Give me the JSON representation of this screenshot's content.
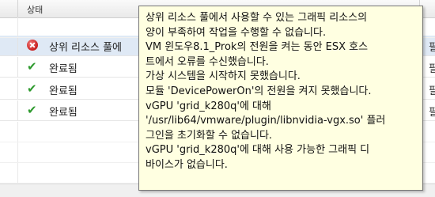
{
  "header": {
    "status_column": "상태"
  },
  "rows": [
    {
      "status": "error",
      "icon": "error-icon",
      "label": "상위 리소스 풀에",
      "right": "필"
    },
    {
      "status": "done",
      "icon": "checkmark-icon",
      "label": "완료됨",
      "right": "필"
    },
    {
      "status": "done",
      "icon": "checkmark-icon",
      "label": "완료됨",
      "right": "필"
    },
    {
      "status": "done",
      "icon": "checkmark-icon",
      "label": "완료됨",
      "right": "필"
    }
  ],
  "tooltip": {
    "lines": [
      "상위 리소스 풀에서 사용할 수 있는 그래픽 리소스의",
      "양이 부족하여 작업을 수행할 수 없습니다.",
      "VM 윈도우8.1_Prok의 전원을 켜는 동안 ESX 호스",
      "트에서 오류를 수신했습니다.",
      "가상 시스템을 시작하지 못했습니다.",
      "모듈 'DevicePowerOn'의 전원을 켜지 못했습니다.",
      "vGPU 'grid_k280q'에 대해",
      "'/usr/lib64/vmware/plugin/libnvidia-vgx.so' 플러",
      "그인을 초기화할 수 없습니다.",
      "vGPU 'grid_k280q'에 대해 사용 가능한 그래픽 디",
      "바이스가 없습니다."
    ]
  },
  "colors": {
    "selected_row": "#dfe9f5",
    "tooltip_bg": "#ffffe1",
    "error": "#c81f1f",
    "success": "#2e9a2e"
  }
}
